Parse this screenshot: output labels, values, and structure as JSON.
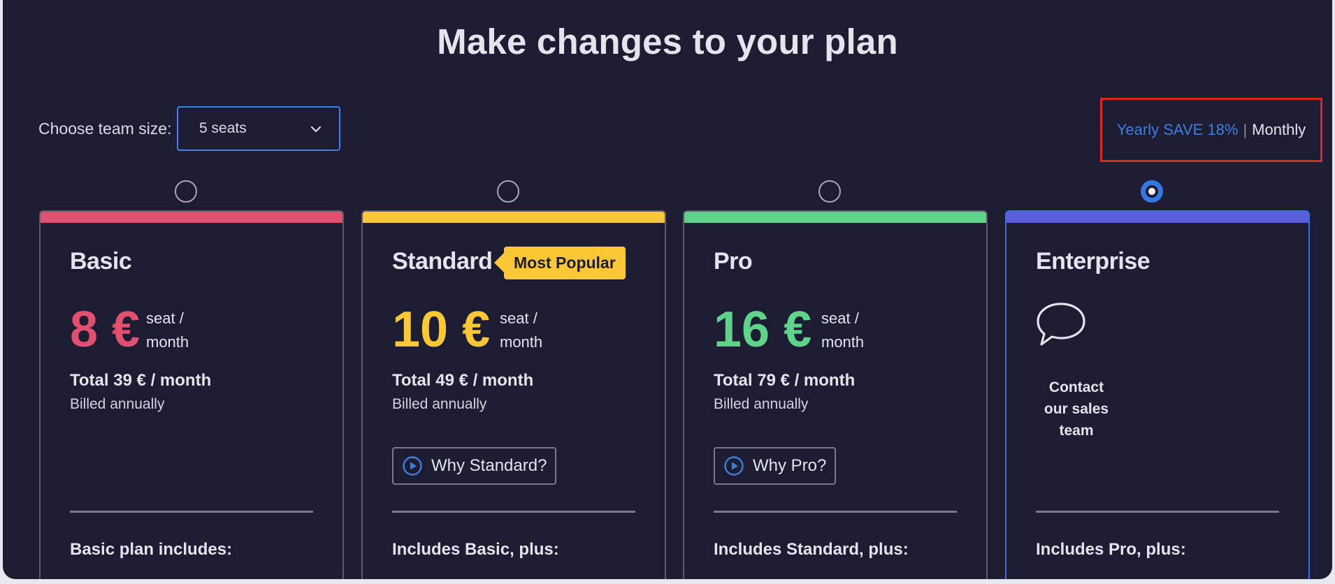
{
  "header": {
    "title": "Make changes to your plan"
  },
  "team_size": {
    "label": "Choose team size:",
    "selected": "5 seats"
  },
  "billing": {
    "yearly_label": "Yearly SAVE 18%",
    "separator": "|",
    "monthly_label": "Monthly"
  },
  "plans": [
    {
      "name": "Basic",
      "accent": "#e2506f",
      "price": "8 €",
      "per_seat": "seat / month",
      "total": "Total 39 € / month",
      "billed": "Billed annually",
      "includes": "Basic plan includes:",
      "selected": false
    },
    {
      "name": "Standard",
      "accent": "#fbc736",
      "badge": "Most Popular",
      "price": "10 €",
      "per_seat": "seat / month",
      "total": "Total 49 € / month",
      "billed": "Billed annually",
      "why_label": "Why Standard?",
      "includes": "Includes Basic, plus:",
      "selected": false
    },
    {
      "name": "Pro",
      "accent": "#5fd38a",
      "price": "16 €",
      "per_seat": "seat / month",
      "total": "Total 79 € / month",
      "billed": "Billed annually",
      "why_label": "Why Pro?",
      "includes": "Includes Standard, plus:",
      "selected": false
    },
    {
      "name": "Enterprise",
      "accent": "#5a5fd9",
      "contact": "Contact our sales team",
      "includes": "Includes Pro, plus:",
      "selected": true
    }
  ],
  "icons": {
    "dropdown": "chevron-down-icon",
    "play": "play-circle-icon",
    "chat": "speech-bubble-icon"
  }
}
